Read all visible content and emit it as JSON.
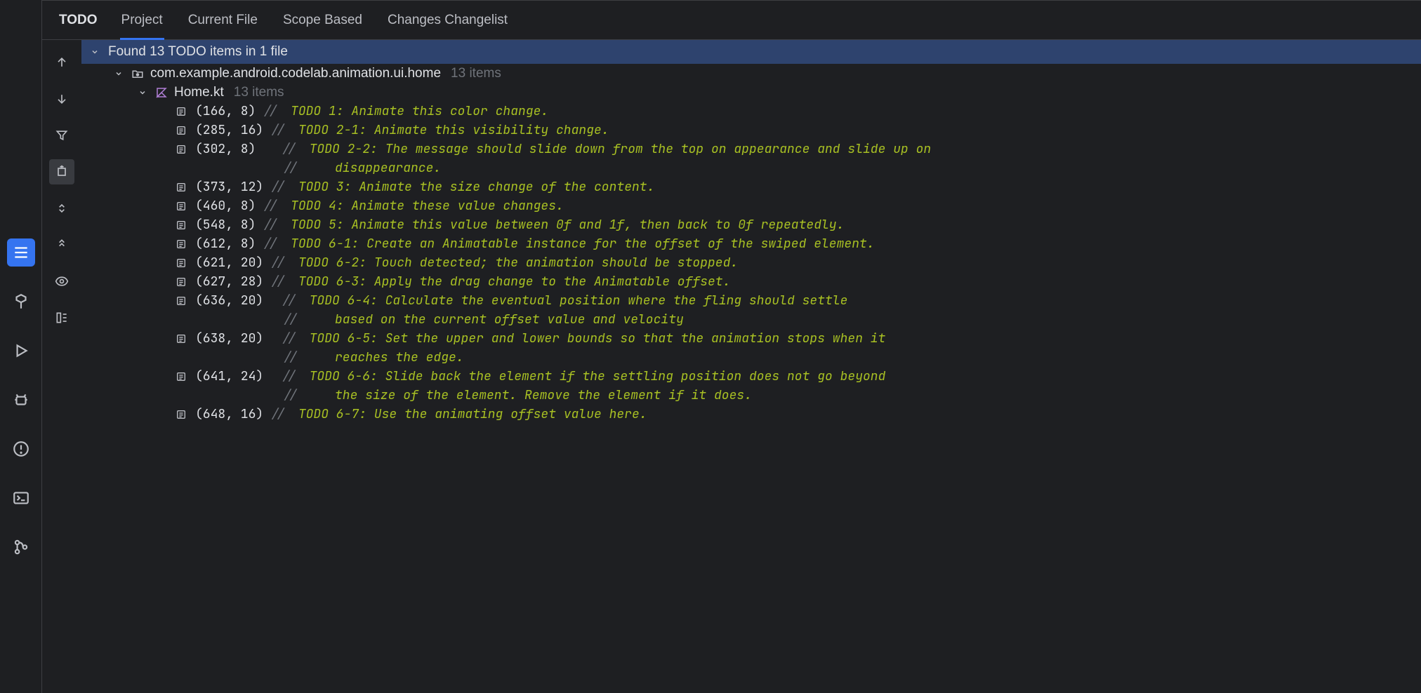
{
  "panel_title": "TODO",
  "tabs": {
    "project": "Project",
    "current_file": "Current File",
    "scope_based": "Scope Based",
    "changes": "Changes Changelist"
  },
  "summary": "Found 13 TODO items in 1 file",
  "package_name": "com.example.android.codelab.animation.ui.home",
  "package_count": "13 items",
  "file_name": "Home.kt",
  "file_count": "13 items",
  "todos": [
    {
      "loc": "(166, 8)",
      "text": "TODO 1: Animate this color change."
    },
    {
      "loc": "(285, 16)",
      "text": "TODO 2-1: Animate this visibility change."
    },
    {
      "loc": "(302, 8)",
      "text": "TODO 2-2: The message should slide down from the top on appearance and slide up on",
      "cont": [
        "disappearance."
      ]
    },
    {
      "loc": "(373, 12)",
      "text": "TODO 3: Animate the size change of the content."
    },
    {
      "loc": "(460, 8)",
      "text": "TODO 4: Animate these value changes."
    },
    {
      "loc": "(548, 8)",
      "text": "TODO 5: Animate this value between 0f and 1f, then back to 0f repeatedly."
    },
    {
      "loc": "(612, 8)",
      "text": "TODO 6-1: Create an Animatable instance for the offset of the swiped element."
    },
    {
      "loc": "(621, 20)",
      "text": "TODO 6-2: Touch detected; the animation should be stopped."
    },
    {
      "loc": "(627, 28)",
      "text": "TODO 6-3: Apply the drag change to the Animatable offset."
    },
    {
      "loc": "(636, 20)",
      "text": "TODO 6-4: Calculate the eventual position where the fling should settle",
      "cont": [
        "based on the current offset value and velocity"
      ]
    },
    {
      "loc": "(638, 20)",
      "text": "TODO 6-5: Set the upper and lower bounds so that the animation stops when it",
      "cont": [
        "reaches the edge."
      ]
    },
    {
      "loc": "(641, 24)",
      "text": "TODO 6-6: Slide back the element if the settling position does not go beyond",
      "cont": [
        "the size of the element. Remove the element if it does."
      ]
    },
    {
      "loc": "(648, 16)",
      "text": "TODO 6-7: Use the animating offset value here."
    }
  ]
}
